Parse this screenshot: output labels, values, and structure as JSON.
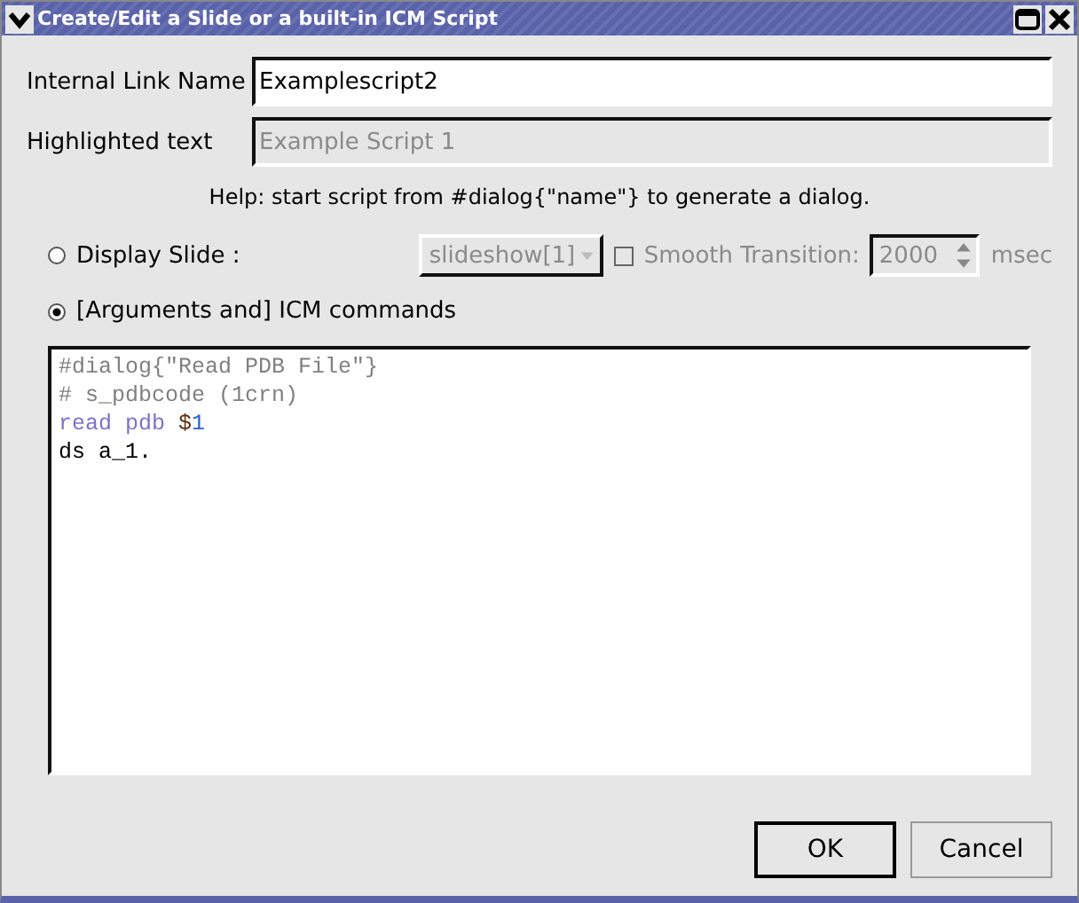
{
  "window": {
    "title": "Create/Edit a Slide or a built-in ICM Script"
  },
  "fields": [
    {
      "label": "Internal Link Name",
      "value": "Examplescript2",
      "disabled": false
    },
    {
      "label": "Highlighted text",
      "value": "Example Script 1",
      "disabled": true
    }
  ],
  "help": "Help: start script from #dialog{\"name\"} to generate a dialog.",
  "display_slide": {
    "label": "Display Slide :",
    "selected": false,
    "slideshow": "slideshow[1]",
    "smooth": {
      "label": "Smooth Transition:",
      "checked": false
    },
    "duration": "2000",
    "unit": "msec"
  },
  "icm": {
    "label": "[Arguments and] ICM commands",
    "selected": true
  },
  "code": [
    [
      {
        "text": "#dialog{\"Read PDB File\"}",
        "color": "#808080"
      }
    ],
    [
      {
        "text": "# s_pdbcode (1crn)",
        "color": "#808080"
      }
    ],
    [
      {
        "text": "read pdb ",
        "color": "#8070c8"
      },
      {
        "text": "$",
        "color": "#603010"
      },
      {
        "text": "1",
        "color": "#2060e0"
      }
    ],
    [
      {
        "text": "ds a_1.",
        "color": "#000000"
      }
    ]
  ],
  "buttons": [
    "OK",
    "Cancel"
  ]
}
